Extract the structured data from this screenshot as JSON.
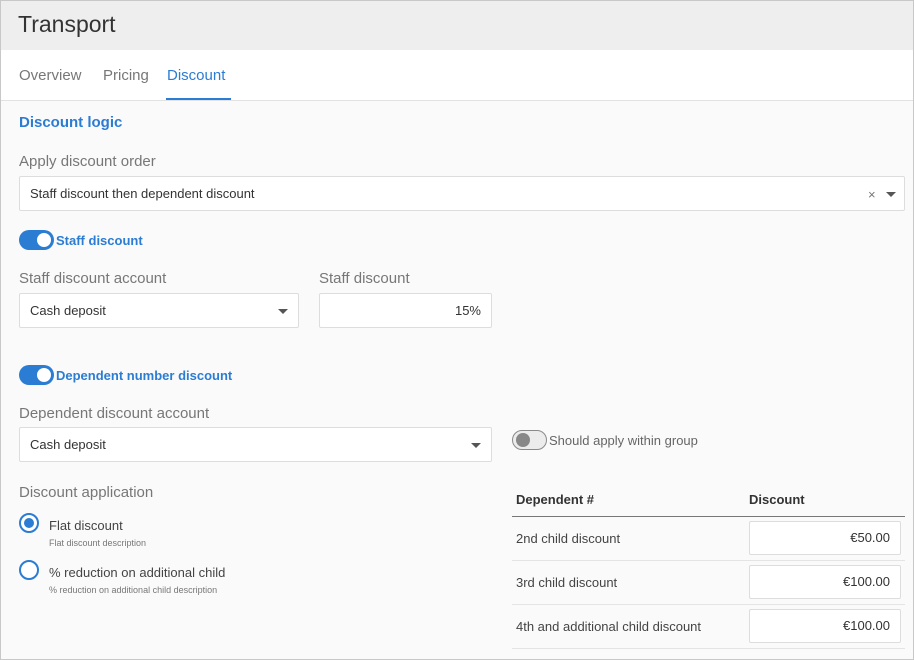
{
  "app": {
    "title": "Transport"
  },
  "tabs": [
    {
      "label": "Overview",
      "active": false
    },
    {
      "label": "Pricing",
      "active": false
    },
    {
      "label": "Discount",
      "active": true
    }
  ],
  "colors": {
    "accent": "#2b7cd3"
  },
  "discount_logic": {
    "title": "Discount logic",
    "apply_order": {
      "label": "Apply discount order",
      "value": "Staff discount then dependent discount",
      "clear_glyph": "×"
    },
    "staff": {
      "toggle_label": "Staff discount",
      "enabled": true,
      "account_label": "Staff discount account",
      "account_value": "Cash deposit",
      "discount_label": "Staff discount",
      "discount_value": "15%"
    },
    "dependent": {
      "toggle_label": "Dependent number discount",
      "enabled": true,
      "account_label": "Dependent discount account",
      "account_value": "Cash deposit",
      "within_group_label": "Should apply within group",
      "within_group_enabled": false
    },
    "application": {
      "label": "Discount application",
      "options": [
        {
          "label": "Flat discount",
          "description": "Flat discount description",
          "checked": true
        },
        {
          "label": "% reduction on additional child",
          "description": "% reduction on additional child description",
          "checked": false
        }
      ]
    },
    "table": {
      "headers": [
        "Dependent #",
        "Discount"
      ],
      "rows": [
        {
          "label": "2nd child discount",
          "value": "€50.00"
        },
        {
          "label": "3rd child discount",
          "value": "€100.00"
        },
        {
          "label": "4th and additional child discount",
          "value": "€100.00"
        }
      ]
    }
  }
}
